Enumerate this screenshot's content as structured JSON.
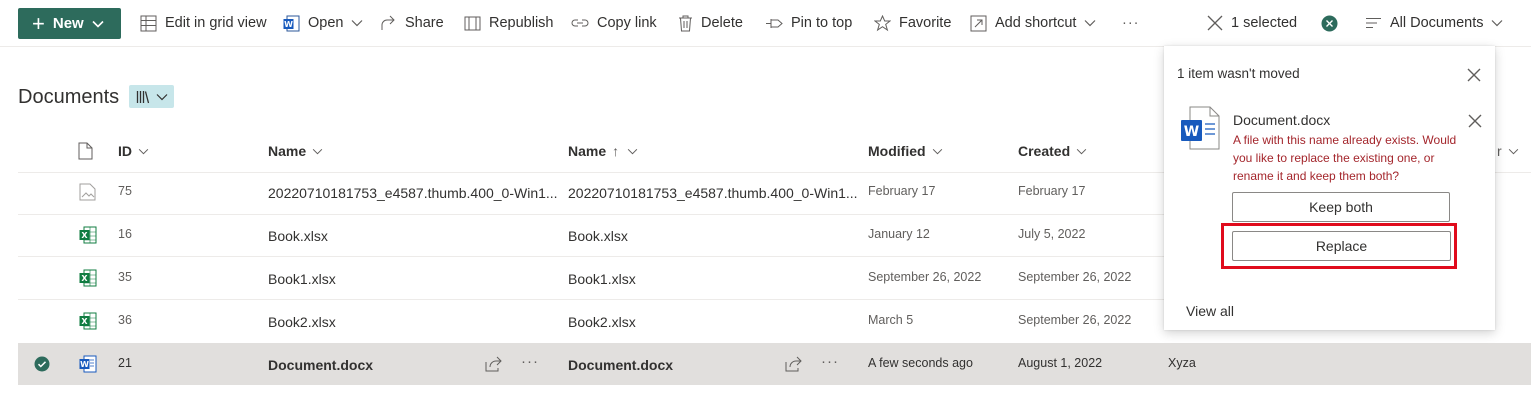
{
  "toolbar": {
    "new_label": "New",
    "edit_grid": "Edit in grid view",
    "open": "Open",
    "share": "Share",
    "republish": "Republish",
    "copy_link": "Copy link",
    "delete": "Delete",
    "pin_to_top": "Pin to top",
    "favorite": "Favorite",
    "add_shortcut": "Add shortcut",
    "more": "···",
    "selected": "1 selected",
    "view": "All Documents"
  },
  "library": {
    "title": "Documents"
  },
  "columns": {
    "id": "ID",
    "name1": "Name",
    "name2": "Name",
    "sort_arrow": "↑",
    "modified": "Modified",
    "created": "Created",
    "partial_col": "r"
  },
  "rows": [
    {
      "id": "75",
      "name": "20220710181753_e4587.thumb.400_0-Win1...",
      "name2": "20220710181753_e4587.thumb.400_0-Win1...",
      "modified": "February 17",
      "created": "February 17",
      "icon": "image-file-icon"
    },
    {
      "id": "16",
      "name": "Book.xlsx",
      "name2": "Book.xlsx",
      "modified": "January 12",
      "created": "July 5, 2022",
      "icon": "excel-file-icon"
    },
    {
      "id": "35",
      "name": "Book1.xlsx",
      "name2": "Book1.xlsx",
      "modified": "September 26, 2022",
      "created": "September 26, 2022",
      "icon": "excel-file-icon"
    },
    {
      "id": "36",
      "name": "Book2.xlsx",
      "name2": "Book2.xlsx",
      "modified": "March 5",
      "created": "September 26, 2022",
      "icon": "excel-file-icon"
    },
    {
      "id": "21",
      "name": "Document.docx",
      "name2": "Document.docx",
      "modified": "A few seconds ago",
      "created": "August 1, 2022",
      "modified_by": "Xyza",
      "icon": "word-file-icon",
      "selected": true
    }
  ],
  "panel": {
    "title": "1 item wasn't moved",
    "file_name": "Document.docx",
    "error": "A file with this name already exists. Would you like to replace the existing one, or rename it and keep them both?",
    "keep_both": "Keep both",
    "replace": "Replace",
    "view_all": "View all"
  },
  "colors": {
    "brand": "#2d6b5c",
    "error": "#a4262c",
    "highlight": "#e00b1c",
    "selected_row": "#e1dfdd",
    "word": "#185abd",
    "excel": "#107c41"
  }
}
